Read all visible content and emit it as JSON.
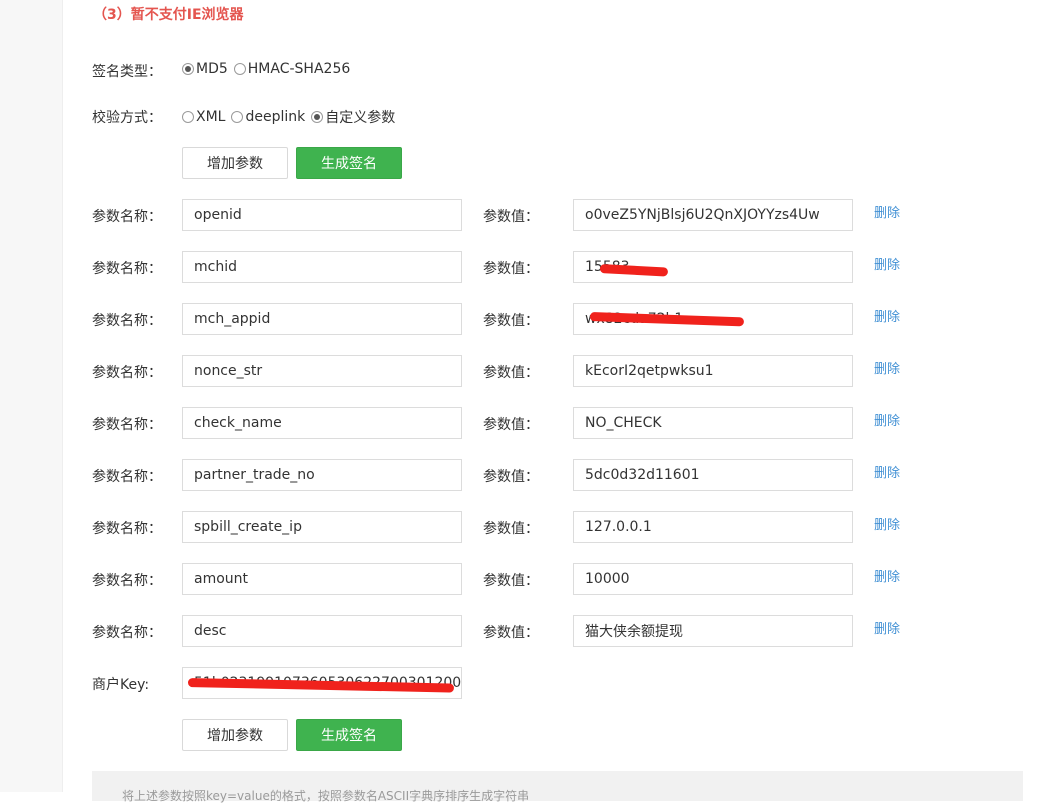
{
  "notice": "（3）暂不支付IE浏览器",
  "sign_type": {
    "label": "签名类型：",
    "options": [
      {
        "label": "MD5",
        "checked": true
      },
      {
        "label": "HMAC-SHA256",
        "checked": false
      }
    ]
  },
  "verify_method": {
    "label": "校验方式：",
    "options": [
      {
        "label": "XML",
        "checked": false
      },
      {
        "label": "deeplink",
        "checked": false
      },
      {
        "label": "自定义参数",
        "checked": true
      }
    ]
  },
  "buttons": {
    "add_param": "增加参数",
    "generate_sign": "生成签名"
  },
  "labels": {
    "param_name": "参数名称：",
    "param_value": "参数值：",
    "delete": "删除",
    "merchant_key": "商户Key:"
  },
  "params": [
    {
      "name": "openid",
      "value": "o0veZ5YNjBlsj6U2QnXJOYYzs4Uw"
    },
    {
      "name": "mchid",
      "value": "15583"
    },
    {
      "name": "mch_appid",
      "value": "wx82cda72b1"
    },
    {
      "name": "nonce_str",
      "value": "kEcorI2qetpwksu1"
    },
    {
      "name": "check_name",
      "value": "NO_CHECK"
    },
    {
      "name": "partner_trade_no",
      "value": "5dc0d32d11601"
    },
    {
      "name": "spbill_create_ip",
      "value": "127.0.0.1"
    },
    {
      "name": "amount",
      "value": "10000"
    },
    {
      "name": "desc",
      "value": "猫大侠余额提现"
    }
  ],
  "merchant_key_value": "51b0231991073605306227003012007",
  "bottom_text": "将上述参数按照key=value的格式，按照参数名ASCII字典序排序生成字符串",
  "colors": {
    "notice": "#e4554f",
    "primary_button": "#3fb34f",
    "delete_link": "#3f8fd4",
    "redaction": "#f0221c"
  }
}
